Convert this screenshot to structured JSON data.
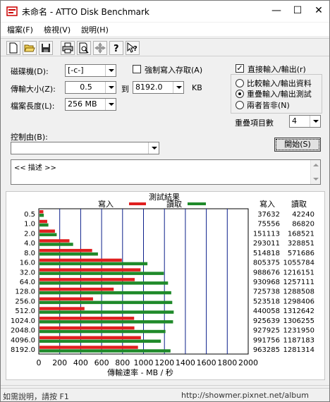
{
  "window": {
    "title": "未命名 - ATTO Disk Benchmark",
    "minimize": "—",
    "maximize": "☐",
    "close": "✕"
  },
  "menu": {
    "file": "檔案(F)",
    "view": "檢視(V)",
    "help": "說明(H)"
  },
  "toolbar": [
    "new-icon",
    "open-icon",
    "save-icon",
    "print-icon",
    "print-preview-icon",
    "move-icon",
    "help-icon",
    "context-help-icon"
  ],
  "form": {
    "drive_label": "磁碟機(D):",
    "drive_value": "[-c-]",
    "force_write_label": "強制寫入存取(A)",
    "transfer_label": "傳輸大小(Z):",
    "transfer_from": "0.5",
    "to_label": "到",
    "transfer_to": "8192.0",
    "kb_label": "KB",
    "file_length_label": "檔案長度(L):",
    "file_length_value": "256 MB",
    "control_label": "控制由(B):",
    "control_value": "",
    "direct_io_label": "直接輸入/輸出(r)",
    "direct_io_checked": "✓",
    "radio_compare": "比較輸入/輸出資料",
    "radio_overlap": "重疊輸入/輸出測試",
    "radio_neither": "兩者皆非(N)",
    "queue_label": "重疊項目數",
    "queue_value": "4",
    "start_button": "開始(S)",
    "description": "<< 描述 >>"
  },
  "status": {
    "left": "如需說明，請按 F1",
    "right": "http://showmer.pixnet.net/album"
  },
  "colors": {
    "write": "#e01f1f",
    "read": "#1f8a2a",
    "grid": "#0b1f8a"
  },
  "chart_data": {
    "type": "bar",
    "title": "測試結果",
    "xlabel": "傳輸速率 - MB / 秒",
    "xlim": [
      0,
      2000
    ],
    "xticks": [
      "0",
      "200",
      "400",
      "600",
      "800",
      "1000",
      "1200",
      "1400",
      "1600",
      "1800",
      "2000"
    ],
    "categories": [
      "0.5",
      "1.0",
      "2.0",
      "4.0",
      "8.0",
      "16.0",
      "32.0",
      "64.0",
      "128.0",
      "256.0",
      "512.0",
      "1024.0",
      "2048.0",
      "4096.0",
      "8192.0"
    ],
    "legend": {
      "write": "寫入",
      "read": "讀取"
    },
    "table_headers": {
      "write": "寫入",
      "read": "讀取"
    },
    "series": [
      {
        "name": "寫入",
        "values": [
          37632,
          75556,
          151113,
          293011,
          514818,
          805375,
          988676,
          930968,
          725738,
          523518,
          440058,
          925639,
          927925,
          991756,
          963285
        ]
      },
      {
        "name": "讀取",
        "values": [
          42240,
          86820,
          168521,
          328851,
          571686,
          1055784,
          1216151,
          1257111,
          1288508,
          1298406,
          1312642,
          1306255,
          1231950,
          1187183,
          1281314
        ]
      }
    ]
  }
}
